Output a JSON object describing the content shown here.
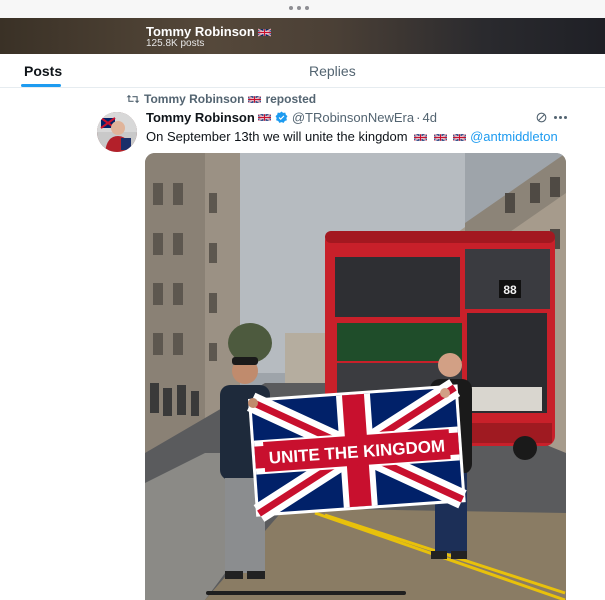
{
  "banner": {
    "name": "Tommy Robinson",
    "flag": "uk-flag-emoji",
    "posts_count": "125.8K posts"
  },
  "tabs": [
    {
      "label": "Posts",
      "active": true
    },
    {
      "label": "Replies",
      "active": false
    }
  ],
  "repost": {
    "icon": "repost-icon",
    "text": "Tommy Robinson",
    "flag": "uk-flag-emoji",
    "suffix": "reposted"
  },
  "post": {
    "author_name": "Tommy Robinson",
    "author_flag": "uk-flag-emoji",
    "verified": true,
    "handle": "@TRobinsonNewEra",
    "separator": "·",
    "time": "4d",
    "text": "On September 13th we will unite the kingdom",
    "text_flags": [
      "uk-flag-emoji",
      "uk-flag-emoji",
      "uk-flag-emoji"
    ],
    "mention": "@antmiddleton",
    "image": {
      "flag_banner_text": "UNITE THE KINGDOM",
      "bus_route_number": "88",
      "description_icon": "photo-street-scene"
    }
  },
  "colors": {
    "accent": "#1d9bf0",
    "text_primary": "#0f1419",
    "text_secondary": "#536471",
    "bus_red": "#d3242c"
  }
}
